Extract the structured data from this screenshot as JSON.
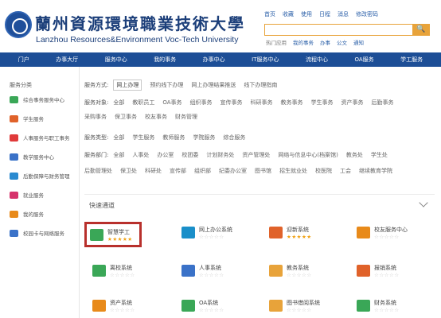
{
  "header": {
    "logo_cn": "蘭州資源環境職業技術大學",
    "logo_en": "Lanzhou Resources&Environment Voc-Tech University",
    "toplinks": [
      "首页",
      "收藏",
      "使用",
      "日程",
      "消息",
      "修改密码"
    ],
    "search": {
      "placeholder": "",
      "button": "🔍"
    },
    "hotwords": [
      "热门应用",
      "我的事务",
      "办事",
      "公文",
      "通知"
    ]
  },
  "nav": {
    "items": [
      "门户",
      "办事大厅",
      "服务中心",
      "我的事务",
      "办事中心",
      "IT服务中心",
      "流程中心",
      "OA服务",
      "学工服务"
    ]
  },
  "sidebar": {
    "title": "服务分类",
    "items": [
      {
        "label": "综合事务服务中心",
        "color": "#3aa757"
      },
      {
        "label": "学生服务",
        "color": "#e0622a"
      },
      {
        "label": "人事服务与职工事务",
        "color": "#e03a3a"
      },
      {
        "label": "教学服务中心",
        "color": "#3a72c8"
      },
      {
        "label": "后勤保障与财务管理",
        "color": "#2a8ad0"
      },
      {
        "label": "就业服务",
        "color": "#d6336c"
      },
      {
        "label": "我的服务",
        "color": "#e88a1a"
      },
      {
        "label": "校园卡与网络服务",
        "color": "#3a72c8"
      }
    ]
  },
  "filters": {
    "row1": {
      "label": "服务方式:",
      "options": [
        "网上办理",
        "预约线下办理",
        "网上办理结果推送",
        "线下办理指南"
      ],
      "active": 0
    },
    "row2": {
      "label": "服务对象:",
      "options": [
        "全部",
        "教职员工",
        "OA事务",
        "组织事务",
        "宣传事务",
        "科研事务",
        "教务事务",
        "学生事务",
        "资产事务",
        "后勤事务",
        "采购事务",
        "保卫事务",
        "校友事务",
        "财务管理"
      ],
      "active": -1
    },
    "row3": {
      "label": "服务类型:",
      "options": [
        "全部",
        "学生服务",
        "教师服务",
        "学院服务",
        "综合服务"
      ],
      "active": -1
    },
    "row4": {
      "label": "服务部门:",
      "options": [
        "全部",
        "人事处",
        "办公室",
        "校团委",
        "计划财务处",
        "资产管理处",
        "网络与信息中心(档案馆)",
        "教务处",
        "学生处",
        "后勤管理处",
        "保卫处",
        "科研处",
        "宣传部",
        "组织部",
        "纪委办公室",
        "图书馆",
        "招生就业处",
        "校医院",
        "工会",
        "继续教育学院"
      ],
      "active": -1
    }
  },
  "services": {
    "title": "快速通道",
    "cards": [
      {
        "name": "智慧学工",
        "stars": "★★★★★",
        "rated": true,
        "color": "#3aa757",
        "highlight": true
      },
      {
        "name": "网上办公系统",
        "stars": "☆☆☆☆☆",
        "rated": false,
        "color": "#1a8fc9",
        "highlight": false
      },
      {
        "name": "迎新系统",
        "stars": "★★★★★",
        "rated": true,
        "color": "#e0622a",
        "highlight": false
      },
      {
        "name": "校友服务中心",
        "stars": "☆☆☆☆☆",
        "rated": false,
        "color": "#e88a1a",
        "highlight": false
      },
      {
        "name": "离校系统",
        "stars": "☆☆☆☆☆",
        "rated": false,
        "color": "#3aa757",
        "highlight": false
      },
      {
        "name": "人事系统",
        "stars": "☆☆☆☆☆",
        "rated": false,
        "color": "#3a72c8",
        "highlight": false
      },
      {
        "name": "教务系统",
        "stars": "☆☆☆☆☆",
        "rated": false,
        "color": "#e8a33a",
        "highlight": false
      },
      {
        "name": "报销系统",
        "stars": "☆☆☆☆☆",
        "rated": false,
        "color": "#e0622a",
        "highlight": false
      },
      {
        "name": "资产系统",
        "stars": "☆☆☆☆☆",
        "rated": false,
        "color": "#e88a1a",
        "highlight": false
      },
      {
        "name": "OA系统",
        "stars": "☆☆☆☆☆",
        "rated": false,
        "color": "#3aa757",
        "highlight": false
      },
      {
        "name": "图书借阅系统",
        "stars": "☆☆☆☆☆",
        "rated": false,
        "color": "#e8a33a",
        "highlight": false
      },
      {
        "name": "财务系统",
        "stars": "☆☆☆☆☆",
        "rated": false,
        "color": "#3aa757",
        "highlight": false
      }
    ]
  }
}
